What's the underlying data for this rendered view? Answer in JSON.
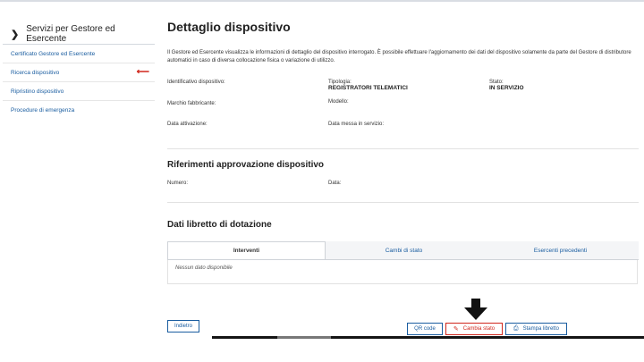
{
  "sidebar": {
    "header": "Servizi per Gestore ed Esercente",
    "items": [
      {
        "label": "Certificato Gestore ed Esercente"
      },
      {
        "label": "Ricerca dispositivo"
      },
      {
        "label": "Ripristino dispositivo"
      },
      {
        "label": "Procedure di emergenza"
      }
    ]
  },
  "page": {
    "title": "Dettaglio dispositivo",
    "intro": "Il Gestore ed Esercente visualizza le informazioni di dettaglio del dispositivo interrogato. È possibile effettuare l'aggiornamento dei dati del dispositivo solamente da parte del Gestore di distributore automatici in caso di diversa collocazione fisica o variazione di utilizzo."
  },
  "details": {
    "identificativo_label": "Identificativo dispositivo:",
    "tipologia_label": "Tipologia:",
    "tipologia_value": "REGISTRATORI TELEMATICI",
    "stato_label": "Stato:",
    "stato_value": "IN SERVIZIO",
    "marchio_label": "Marchio fabbricante:",
    "modello_label": "Modello:",
    "attivazione_label": "Data attivazione:",
    "messa_servizio_label": "Data messa in servizio:"
  },
  "approvazione": {
    "title": "Riferimenti approvazione dispositivo",
    "numero_label": "Numero:",
    "data_label": "Data:"
  },
  "libretto": {
    "title": "Dati libretto di dotazione",
    "tabs": [
      "Interventi",
      "Cambi di stato",
      "Esercenti precedenti"
    ],
    "empty": "Nessun dato disponibile"
  },
  "buttons": {
    "back": "Indietro",
    "qr": "QR code",
    "change_state": "Cambia stato",
    "print": "Stampa libretto"
  },
  "colors": {
    "link": "#1a5da0",
    "accent_red": "#d0271d"
  }
}
